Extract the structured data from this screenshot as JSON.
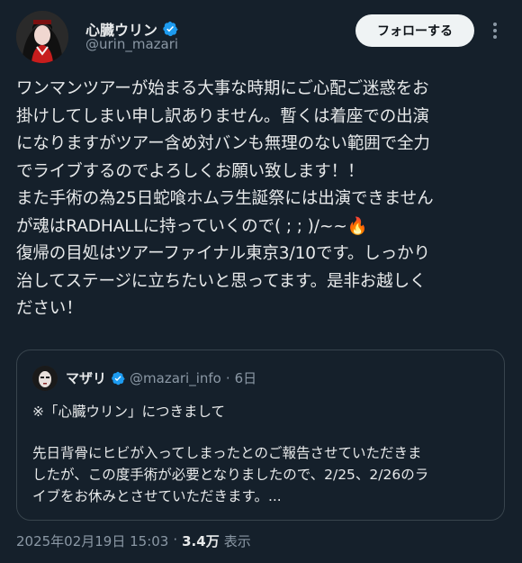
{
  "author": {
    "display_name": "心臓ウリン",
    "handle": "@urin_mazari",
    "verified": true
  },
  "follow_button_label": "フォローする",
  "more_icon": "more-vertical-icon",
  "tweet_lines": [
    "ワンマンツアーが始まる大事な時期にご心配ご迷惑をお",
    "掛けしてしまい申し訳ありません。暫くは着座での出演",
    "になりますがツアー含め対バンも無理のない範囲で全力",
    "でライブするのでよろしくお願い致します！！",
    "また手術の為25日蛇喰ホムラ生誕祭には出演できません",
    "が魂はRADHALLに持っていくので( ; ; )/~~🔥",
    "復帰の目処はツアーファイナル東京3/10です。しっかり",
    "治してステージに立ちたいと思ってます。是非お越しく",
    "ださい！"
  ],
  "quote": {
    "display_name": "マザリ",
    "handle": "@mazari_info",
    "separator": "·",
    "time": "6日",
    "verified": true,
    "first_line": "※「心臓ウリン」につきまして",
    "body_lines": [
      "先日背骨にヒビが入ってしまったとのご報告させていただきま",
      "したが、この度手術が必要となりましたので、2/25、2/26のラ",
      "イブをお休みとさせていただきます。..."
    ]
  },
  "meta": {
    "timestamp": "2025年02月19日 15:03",
    "separator": "·",
    "views_count": "3.4万",
    "views_label": "表示"
  },
  "colors": {
    "background": "#15202b",
    "text": "#e7e9ea",
    "secondary": "#8b98a5",
    "verified": "#1d9bf0",
    "border": "#38444d"
  }
}
